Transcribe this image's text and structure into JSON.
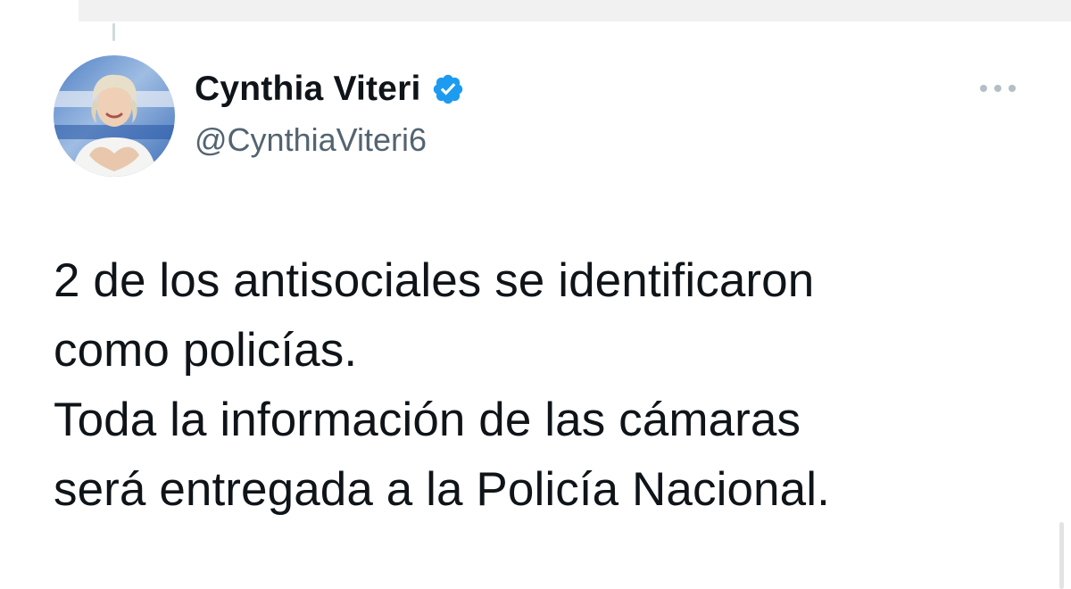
{
  "tweet": {
    "author": {
      "display_name": "Cynthia Viteri",
      "handle": "@CynthiaViteri6",
      "verified": true,
      "avatar_icon": "profile-photo"
    },
    "text": "2 de los antisociales se identificaron\ncomo policías.\nToda la información de las cámaras\nserá entregada a la Policía Nacional.",
    "more_icon": "ellipsis-icon"
  },
  "colors": {
    "text": "#0f1419",
    "secondary": "#536471",
    "verified_blue": "#1d9bf0"
  }
}
